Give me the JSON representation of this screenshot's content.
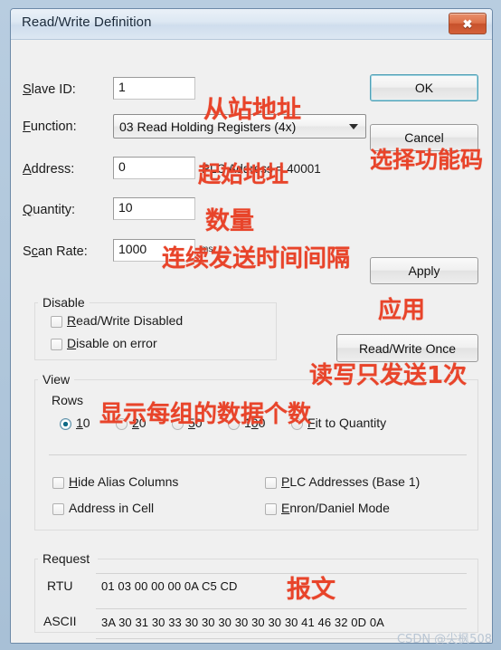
{
  "window": {
    "title": "Read/Write Definition",
    "close_label": "✖"
  },
  "form": {
    "slave_id": {
      "label": "Slave ID:",
      "value": "1"
    },
    "function": {
      "label": "Function:",
      "value": "03 Read Holding Registers (4x)"
    },
    "address": {
      "label": "Address:",
      "value": "0",
      "plc_note": "PLC Address = 40001"
    },
    "quantity": {
      "label": "Quantity:",
      "value": "10"
    },
    "scan_rate": {
      "label": "Scan Rate:",
      "value": "1000",
      "unit": "ms"
    }
  },
  "buttons": {
    "ok": "OK",
    "cancel": "Cancel",
    "apply": "Apply",
    "read_write_once": "Read/Write Once"
  },
  "disable_group": {
    "legend": "Disable",
    "items": [
      {
        "label": "Read/Write Disabled",
        "checked": false
      },
      {
        "label": "Disable on error",
        "checked": false
      }
    ]
  },
  "view_group": {
    "legend": "View",
    "rows_label": "Rows",
    "rows_options": [
      {
        "label": "10",
        "selected": true
      },
      {
        "label": "20",
        "selected": false
      },
      {
        "label": "50",
        "selected": false
      },
      {
        "label": "100",
        "selected": false
      },
      {
        "label": "Fit to Quantity",
        "selected": false
      }
    ],
    "checkboxes": [
      {
        "label": "Hide Alias Columns",
        "checked": false
      },
      {
        "label": "PLC Addresses (Base 1)",
        "checked": false
      },
      {
        "label": "Address in Cell",
        "checked": false
      },
      {
        "label": "Enron/Daniel Mode",
        "checked": false
      }
    ]
  },
  "request_group": {
    "legend": "Request",
    "rtu_key": "RTU",
    "rtu_value": "01 03 00 00 00 0A C5 CD",
    "ascii_key": "ASCII",
    "ascii_value": "3A 30 31 30 33 30 30 30 30 30 30 30 41 46 32 0D 0A"
  },
  "annotations": {
    "slave_id": "从站地址",
    "function": "选择功能码",
    "address": "起始地址",
    "quantity": "数量",
    "scan_rate": "连续发送时间间隔",
    "apply": "应用",
    "read_write_once": "读写只发送1次",
    "rows": "显示每组的数据个数",
    "request": "报文"
  },
  "watermark": "CSDN @尖枫508",
  "colors": {
    "annotation_red": "#e8442a",
    "close_button_red": "#d4603a",
    "default_button_border": "#4f9fb5",
    "dialog_background": "#f0f0f0"
  }
}
